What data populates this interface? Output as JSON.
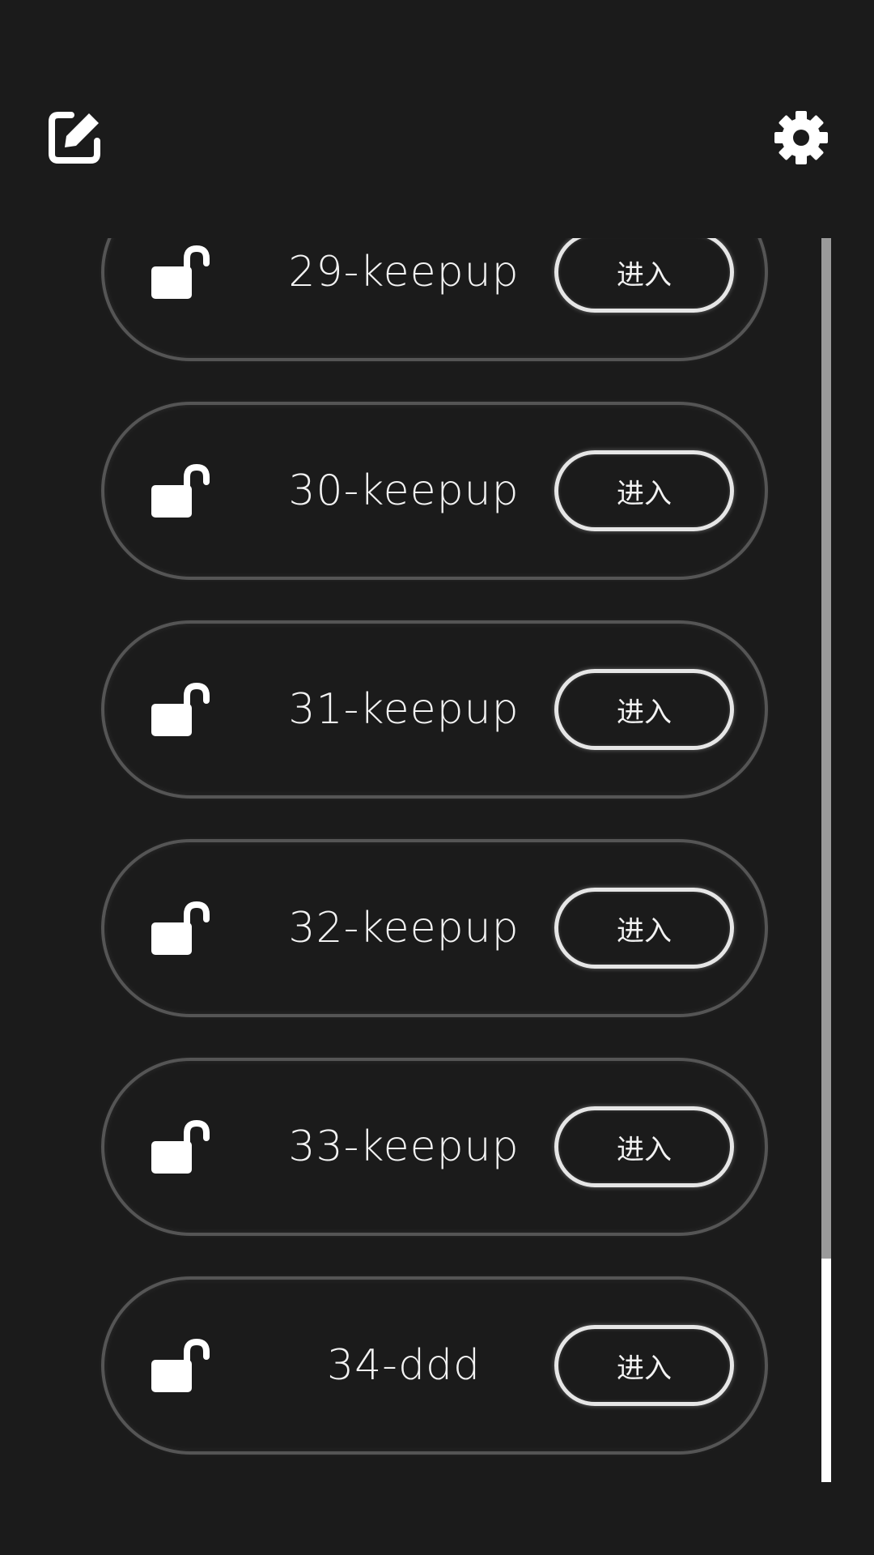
{
  "toolbar": {
    "edit_icon": "edit-icon",
    "settings_icon": "gear-icon"
  },
  "items": [
    {
      "name": "29-keepup",
      "button_label": "进入",
      "icon": "unlock-icon"
    },
    {
      "name": "30-keepup",
      "button_label": "进入",
      "icon": "unlock-icon"
    },
    {
      "name": "31-keepup",
      "button_label": "进入",
      "icon": "unlock-icon"
    },
    {
      "name": "32-keepup",
      "button_label": "进入",
      "icon": "unlock-icon"
    },
    {
      "name": "33-keepup",
      "button_label": "进入",
      "icon": "unlock-icon"
    },
    {
      "name": "34-ddd",
      "button_label": "进入",
      "icon": "unlock-icon"
    }
  ],
  "scrollbar": {
    "thumb_start_fraction": 0.82,
    "thumb_end_fraction": 1.0
  },
  "colors": {
    "background": "#1b1b1b",
    "item_border": "#555555",
    "button_border": "#e6e6e6",
    "scroll_track": "#9a9a9a",
    "scroll_thumb": "#ffffff"
  }
}
